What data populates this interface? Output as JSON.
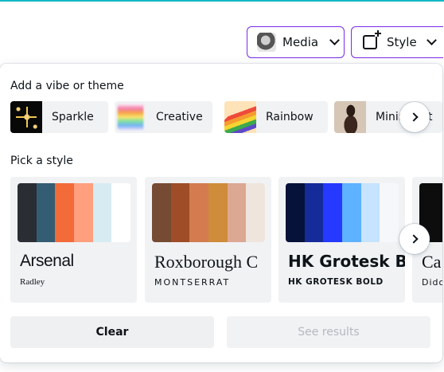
{
  "toolbar": {
    "media_label": "Media",
    "style_label": "Style"
  },
  "vibes": {
    "title": "Add a vibe or theme",
    "items": [
      {
        "label": "Sparkle",
        "thumb": "sparkle-image"
      },
      {
        "label": "Creative",
        "thumb": "creative-image"
      },
      {
        "label": "Rainbow",
        "thumb": "rainbow-image"
      },
      {
        "label": "Minimalist",
        "thumb": "minimalist-image"
      }
    ]
  },
  "styles": {
    "title": "Pick a style",
    "items": [
      {
        "font": "Arsenal",
        "subfont": "Radley",
        "palette": [
          "#2a2d33",
          "#345d73",
          "#f26b38",
          "#ff9f7e",
          "#d6ecf2",
          "#ffffff"
        ]
      },
      {
        "font": "Roxborough C",
        "subfont": "MONTSERRAT",
        "palette": [
          "#754b34",
          "#9e4d26",
          "#d47c4f",
          "#cf8c3a",
          "#dca892",
          "#efe5dd"
        ]
      },
      {
        "font": "HK Grotesk B",
        "subfont": "HK GROTESK BOLD",
        "palette": [
          "#07123a",
          "#162b9a",
          "#2639ff",
          "#5fb2ff",
          "#c6e3ff",
          "#f5f7fb"
        ]
      },
      {
        "font": "Ca",
        "subfont": "Dido",
        "palette": [
          "#0d0d0d",
          "#f3f3f3"
        ]
      }
    ]
  },
  "actions": {
    "clear_label": "Clear",
    "results_label": "See results"
  }
}
